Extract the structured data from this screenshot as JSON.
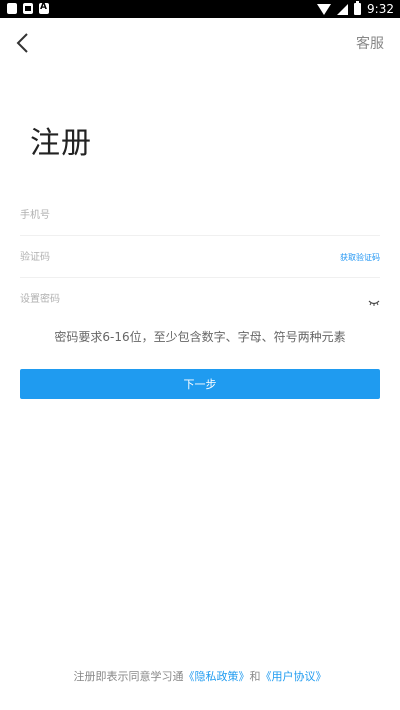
{
  "status_bar": {
    "time": "9:32"
  },
  "header": {
    "service_label": "客服"
  },
  "page_title": "注册",
  "form": {
    "phone_placeholder": "手机号",
    "code_placeholder": "验证码",
    "get_code_label": "获取验证码",
    "password_placeholder": "设置密码",
    "password_hint": "密码要求6-16位，至少包含数字、字母、符号两种元素",
    "next_label": "下一步"
  },
  "agreement": {
    "prefix": "注册即表示同意学习通",
    "privacy_link": "《隐私政策》",
    "and": "和",
    "user_link": "《用户协议》"
  },
  "colors": {
    "accent": "#1f9bf0",
    "statusbar": "#000000"
  }
}
